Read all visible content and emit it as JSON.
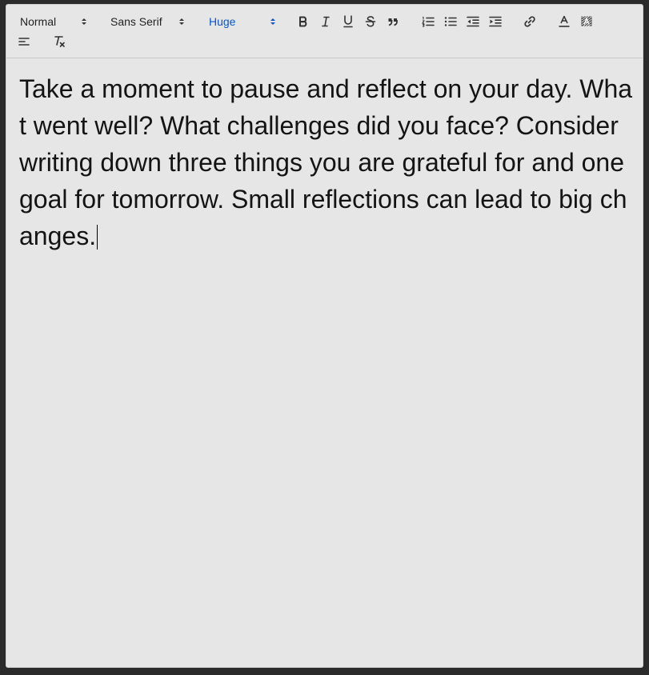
{
  "toolbar": {
    "header_picker": {
      "value": "Normal"
    },
    "font_picker": {
      "value": "Sans Serif"
    },
    "size_picker": {
      "value": "Huge"
    },
    "buttons": [
      {
        "name": "bold-icon"
      },
      {
        "name": "italic-icon"
      },
      {
        "name": "underline-icon"
      },
      {
        "name": "strike-icon"
      },
      {
        "name": "blockquote-icon"
      },
      {
        "name": "ordered-list-icon"
      },
      {
        "name": "bullet-list-icon"
      },
      {
        "name": "outdent-icon"
      },
      {
        "name": "indent-icon"
      },
      {
        "name": "link-icon"
      },
      {
        "name": "text-color-icon"
      },
      {
        "name": "background-color-icon"
      },
      {
        "name": "align-left-icon"
      },
      {
        "name": "clear-format-icon"
      }
    ],
    "colors": {
      "active_picker": "#0a55c4",
      "icon": "#333333"
    }
  },
  "editor": {
    "text": "Take a moment to pause and reflect on your day. What went well? What challenges did you face? Consider writing down three things you are grateful for and one goal for tomorrow. Small reflections can lead to big changes.",
    "background": "#e6e6e6",
    "text_color": "#141414"
  }
}
